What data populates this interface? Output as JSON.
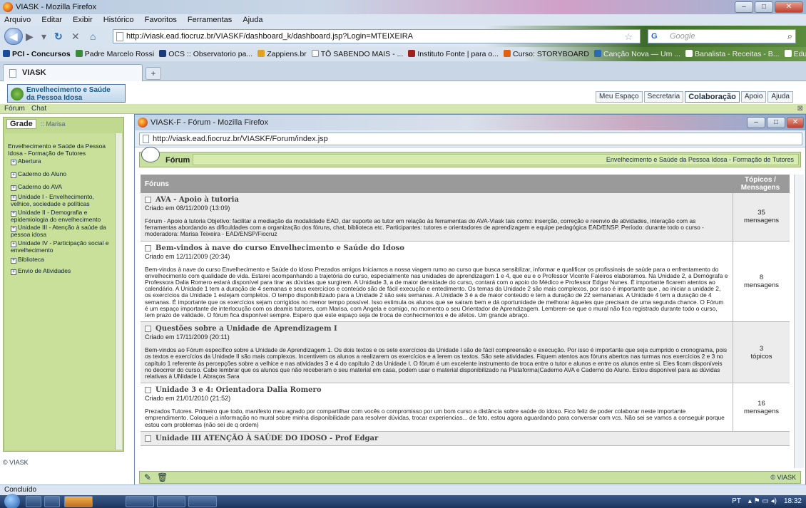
{
  "browser": {
    "title": "VIASK - Mozilla Firefox",
    "menu": [
      "Arquivo",
      "Editar",
      "Exibir",
      "Histórico",
      "Favoritos",
      "Ferramentas",
      "Ajuda"
    ],
    "url": "http://viask.ead.fiocruz.br/VIASKF/dashboard_k/dashboard.jsp?Login=MTEIXEIRA",
    "search_placeholder": "Google",
    "search_engine": "G",
    "bookmarks": [
      "PCI - Concursos",
      "Padre Marcelo Rossi",
      "OCS :: Observatorio pa...",
      "Zappiens.br",
      "TÔ SABENDO MAIS - ...",
      "Instituto Fonte | para o...",
      "Curso: STORYBOARD",
      "Canção Nova — Um ...",
      "Banalista - Receitas - B...",
      "EduTecNet"
    ],
    "tab_label": "VIASK",
    "status": "Concluído"
  },
  "app": {
    "logo_line1": "Envelhecimento e Saúde",
    "logo_line2": "da Pessoa Idosa",
    "top_nav": [
      "Meu Espaço",
      "Secretaria",
      "Colaboração",
      "Apoio",
      "Ajuda"
    ],
    "strip": [
      "Fórum",
      "Chat"
    ],
    "footer": "© VIASK"
  },
  "sidebar": {
    "tab": "Grade",
    "user": ":: Marisa",
    "items": [
      "Envelhecimento e Saúde da Pessoa Idosa - Formação de Tutores",
      "Abertura",
      "Caderno do Aluno",
      "Caderno do AVA",
      "Unidade I - Envelhecimento, velhice, sociedade e políticas",
      "Unidade II - Demografia e epidemiologia do envelhecimento",
      "Unidade III - Atenção à saúde da pessoa idosa",
      "Unidade IV - Participação social e envelhecimento",
      "Biblioteca",
      "Envio de Atividades"
    ]
  },
  "popup": {
    "title": "VIASK-F - Fórum - Mozilla Firefox",
    "url": "http://viask.ead.fiocruz.br/VIASKF/Forum/index.jsp",
    "forum_label": "Fórum",
    "course": "Envelhecimento e Saúde da Pessoa Idosa - Formação de Tutores",
    "col_forums": "Fóruns",
    "col_count_1": "Tópicos /",
    "col_count_2": "Mensagens",
    "footer": "© VIASK",
    "rows": [
      {
        "title": "AVA - Apoio à tutoria",
        "created": "Criado em 08/11/2009 (13:09)",
        "desc": "Fórum - Apoio à tutoria Objetivo: facilitar a mediação da modalidade EAD, dar suporte ao tutor em relação às ferramentas do AVA-Viask tais como: inserção, correção e reenvio de atividades, interação com as ferramentas abordando as dificuldades com a organização dos fóruns, chat, biblioteca etc. Participantes: tutores e orientadores de aprendizagem e equipe pedagógica EAD/ENSP. Período: durante todo o curso - moderadora: Marisa Teixeira - EAD/ENSP/Fiocruz",
        "count": "35",
        "unit": "mensagens"
      },
      {
        "title": "Bem-vindos à nave do curso Envelhecimento e Saúde do Idoso",
        "created": "Criado em 12/11/2009 (20:34)",
        "desc": "Bem-vindos à nave do curso Envelhecimento e Saúde do Idoso Prezados amigos Iniciamos a nossa viagem rumo ao curso que busca sensiblizar, informar e qualificar os profissinais de saúde para o enfrentamento do envelhecimento com qualidade de vida. Estarei acompanhando a trajetória do curso, especialmente nas unidades de aprendizagem 1 e 4, que eu e o Professor Vicente Faleiros elaboramos. Na Unidade 2, a Demógrafa e Professora Dalia Romero estará disponível para tirar as dúvidas que surgirem. A Unidade 3, a de maior densidade do curso, contará com o apoio do Médico e Professor Edgar Nunes. É importante ficarem atentos ao calendário. A Unidade 1 tem a duração de 4 semanas e seus exercícios e conteúdo são de fácil execução e entedimento. Os temas da Unidade 2 são mais complexos, por isso é importante que , ao iniciar a unidade 2, os exercícios da Unidade 1 estejam completos. O tempo disponibilizado para a Unidade 2 são seis semanas. A Unidade 3 é a de maior conteúdo e tem a duração de 22 semananas. A Unidade 4 tem a duração de 4 semanas. É importante que os exercícios sejam corrigidos no menor tempo possível. Isso estimula os alunos que se sairam bem e dá oportunidade de melhorar àqueles que precisam de uma segunda chance. O Fórum é um espaço importante de interlocução com os deamis tutores, com Marisa, com Angela e comigo, no momento o seu Orientador de Aprendizagem. Lembrem-se que o mural não fica registrado durante todo o curso, tem prazo de validade. O fórum fica disponível sempre. Espero que este espaço seja de troca de conhecimentos e de afetos. Um grande abraço.",
        "count": "8",
        "unit": "mensagens"
      },
      {
        "title": "Questões sobre a Unidade de Aprendizagem I",
        "created": "Criado em 17/11/2009 (20:11)",
        "desc": "Bem-vindos ao Fórum específico sobre a Unidade de Aprendizagem 1. Os dois textos e os sete exercícios da Unidade I são de fácil compreensão e execução. Por isso é importante que seja cumprido o cronograma, pois os textos e exercícios da Unidade II são mais complexos. Incentivem os alunos a realizarem os exercícios e a lerem os textos. São sete atividades. Fiquem atentos aos fóruns abertos nas turmas nos exercícios 2 e 3 no capítulo 1 referente às percepções sobre a velhice e nas atividades 3 e 4 do capítulo 2 da Unidade I. O fórum é um excelente instrumento de troca entre o tutor e alunos e entre os alunos entre si. Eles ficam disponíveis no deocrrer do curso. Cabe lembrar que os alunos que não receberam o seu material em casa, podem usar o material disponibilizado na Plataforma(Caderno AVA e Caderno do Aluno. Estou disponível para as dúvidas relativas à UNidade I. Abraços Sara",
        "count": "3",
        "unit": "tópicos"
      },
      {
        "title": "Unidade 3 e 4: Orientadora Dalia Romero",
        "created": "Criado em 21/01/2010 (21:52)",
        "desc": "Prezados Tutores. Primeiro que todo, manifesto meu agrado por compartilhar com vocês o compromisso por um bom curso a distância sobre saúde do idoso. Fico feliz de poder colaborar neste importante emprendimento. Coloquei a informação no mural sobre minha disponibilidade para resolver dúvidas, trocar experiencias... de fato, estou agora aguardando para conversar com vcs. Não sei se vamos a conseguir porque estou com problemas (não sei de q ordem)",
        "count": "16",
        "unit": "mensagens"
      },
      {
        "title": "Unidade III ATENÇÃO À SAÚDE DO IDOSO - Prof Edgar",
        "created": "",
        "desc": "",
        "count": "",
        "unit": ""
      }
    ]
  },
  "taskbar": {
    "lang": "PT",
    "time": "18:32"
  }
}
